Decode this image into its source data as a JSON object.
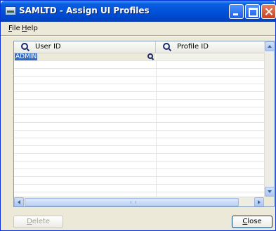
{
  "window": {
    "title": "SAMLTD - Assign UI Profiles"
  },
  "menu": {
    "file": {
      "accel": "F",
      "rest": "ile"
    },
    "help": {
      "accel": "H",
      "rest": "elp"
    }
  },
  "grid": {
    "columns": [
      "User ID",
      "Profile ID"
    ],
    "rows": [
      {
        "user_id": "ADMIN",
        "profile_id": ""
      }
    ]
  },
  "buttons": {
    "delete": {
      "accel": "D",
      "rest": "elete",
      "enabled": false
    },
    "close": {
      "accel": "C",
      "rest": "lose",
      "enabled": true
    }
  },
  "colors": {
    "selection": "#316ac5",
    "titlebar": "#0050d8",
    "face": "#ece9d8"
  }
}
